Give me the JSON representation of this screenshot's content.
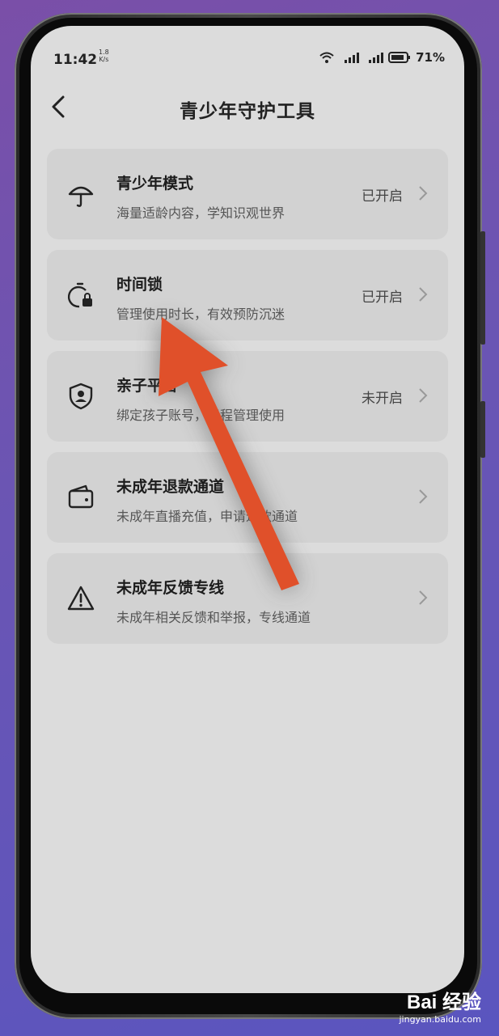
{
  "status": {
    "time": "11:42",
    "speed_value": "1.8",
    "speed_unit": "K/s",
    "battery": "71%"
  },
  "header": {
    "title": "青少年守护工具"
  },
  "cards": [
    {
      "title": "青少年模式",
      "subtitle": "海量适龄内容，学知识观世界",
      "state": "已开启",
      "icon": "umbrella-icon"
    },
    {
      "title": "时间锁",
      "subtitle": "管理使用时长，有效预防沉迷",
      "state": "已开启",
      "icon": "timer-lock-icon"
    },
    {
      "title": "亲子平台",
      "subtitle": "绑定孩子账号，远程管理使用",
      "state": "未开启",
      "icon": "shield-user-icon"
    },
    {
      "title": "未成年退款通道",
      "subtitle": "未成年直播充值，申请退款通道",
      "state": "",
      "icon": "wallet-icon"
    },
    {
      "title": "未成年反馈专线",
      "subtitle": "未成年相关反馈和举报，专线通道",
      "state": "",
      "icon": "warning-icon"
    }
  ],
  "watermark": {
    "logo": "Bai 经验",
    "url": "jingyan.baidu.com"
  },
  "colors": {
    "annotation_arrow": "#e0502a",
    "screen_bg": "#dcdcdc",
    "card_bg": "#d2d2d2"
  }
}
